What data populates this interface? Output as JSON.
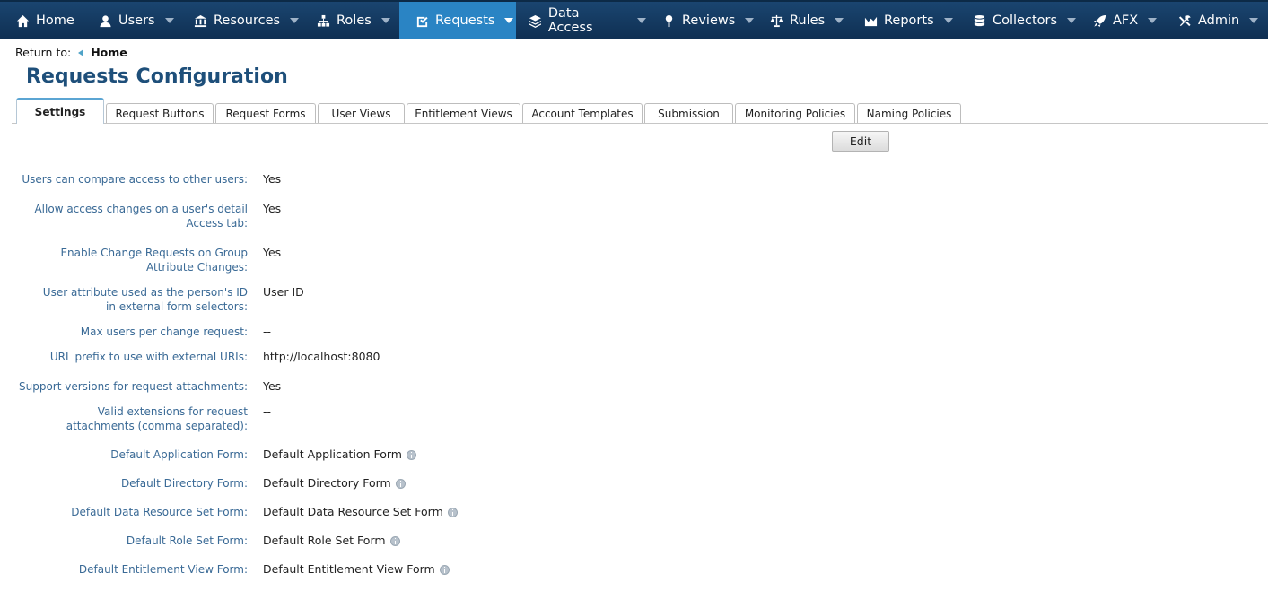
{
  "nav": [
    {
      "label": "Home",
      "icon": "home-icon"
    },
    {
      "label": "Users",
      "icon": "user-icon"
    },
    {
      "label": "Resources",
      "icon": "bank-icon"
    },
    {
      "label": "Roles",
      "icon": "org-chart-icon"
    },
    {
      "label": "Requests",
      "icon": "check-square-icon"
    },
    {
      "label": "Data Access",
      "icon": "layers-icon"
    },
    {
      "label": "Reviews",
      "icon": "pin-icon"
    },
    {
      "label": "Rules",
      "icon": "scales-icon"
    },
    {
      "label": "Reports",
      "icon": "area-chart-icon"
    },
    {
      "label": "Collectors",
      "icon": "database-icon"
    },
    {
      "label": "AFX",
      "icon": "rocket-icon"
    },
    {
      "label": "Admin",
      "icon": "tools-icon"
    }
  ],
  "active_nav": "Requests",
  "breadcrumb": {
    "prefix": "Return to:",
    "link": "Home"
  },
  "page_title": "Requests Configuration",
  "tabs": [
    "Settings",
    "Request Buttons",
    "Request Forms",
    "User Views",
    "Entitlement Views",
    "Account Templates",
    "Submission",
    "Monitoring Policies",
    "Naming Policies"
  ],
  "active_tab": "Settings",
  "edit_label": "Edit",
  "settings": [
    {
      "label": "Users can compare access to other users:",
      "value": "Yes"
    },
    {
      "label": "Allow access changes on a user's detail Access tab:",
      "value": "Yes"
    },
    {
      "label": "Enable Change Requests on Group Attribute Changes:",
      "value": "Yes"
    },
    {
      "label": "User attribute used as the person's ID in external form selectors:",
      "value": "User ID"
    },
    {
      "label": "Max users per change request:",
      "value": "--"
    },
    {
      "label": "URL prefix to use with external URIs:",
      "value": "http://localhost:8080"
    },
    {
      "label": "Support versions for request attachments:",
      "value": "Yes"
    },
    {
      "label": "Valid extensions for request attachments (comma separated):",
      "value": "--"
    },
    {
      "label": "Default Application Form:",
      "value": "Default Application Form"
    },
    {
      "label": "Default Directory Form:",
      "value": "Default Directory Form"
    },
    {
      "label": "Default Data Resource Set Form:",
      "value": "Default Data Resource Set Form"
    },
    {
      "label": "Default Role Set Form:",
      "value": "Default Role Set Form"
    },
    {
      "label": "Default Entitlement View Form:",
      "value": "Default Entitlement View Form"
    }
  ]
}
